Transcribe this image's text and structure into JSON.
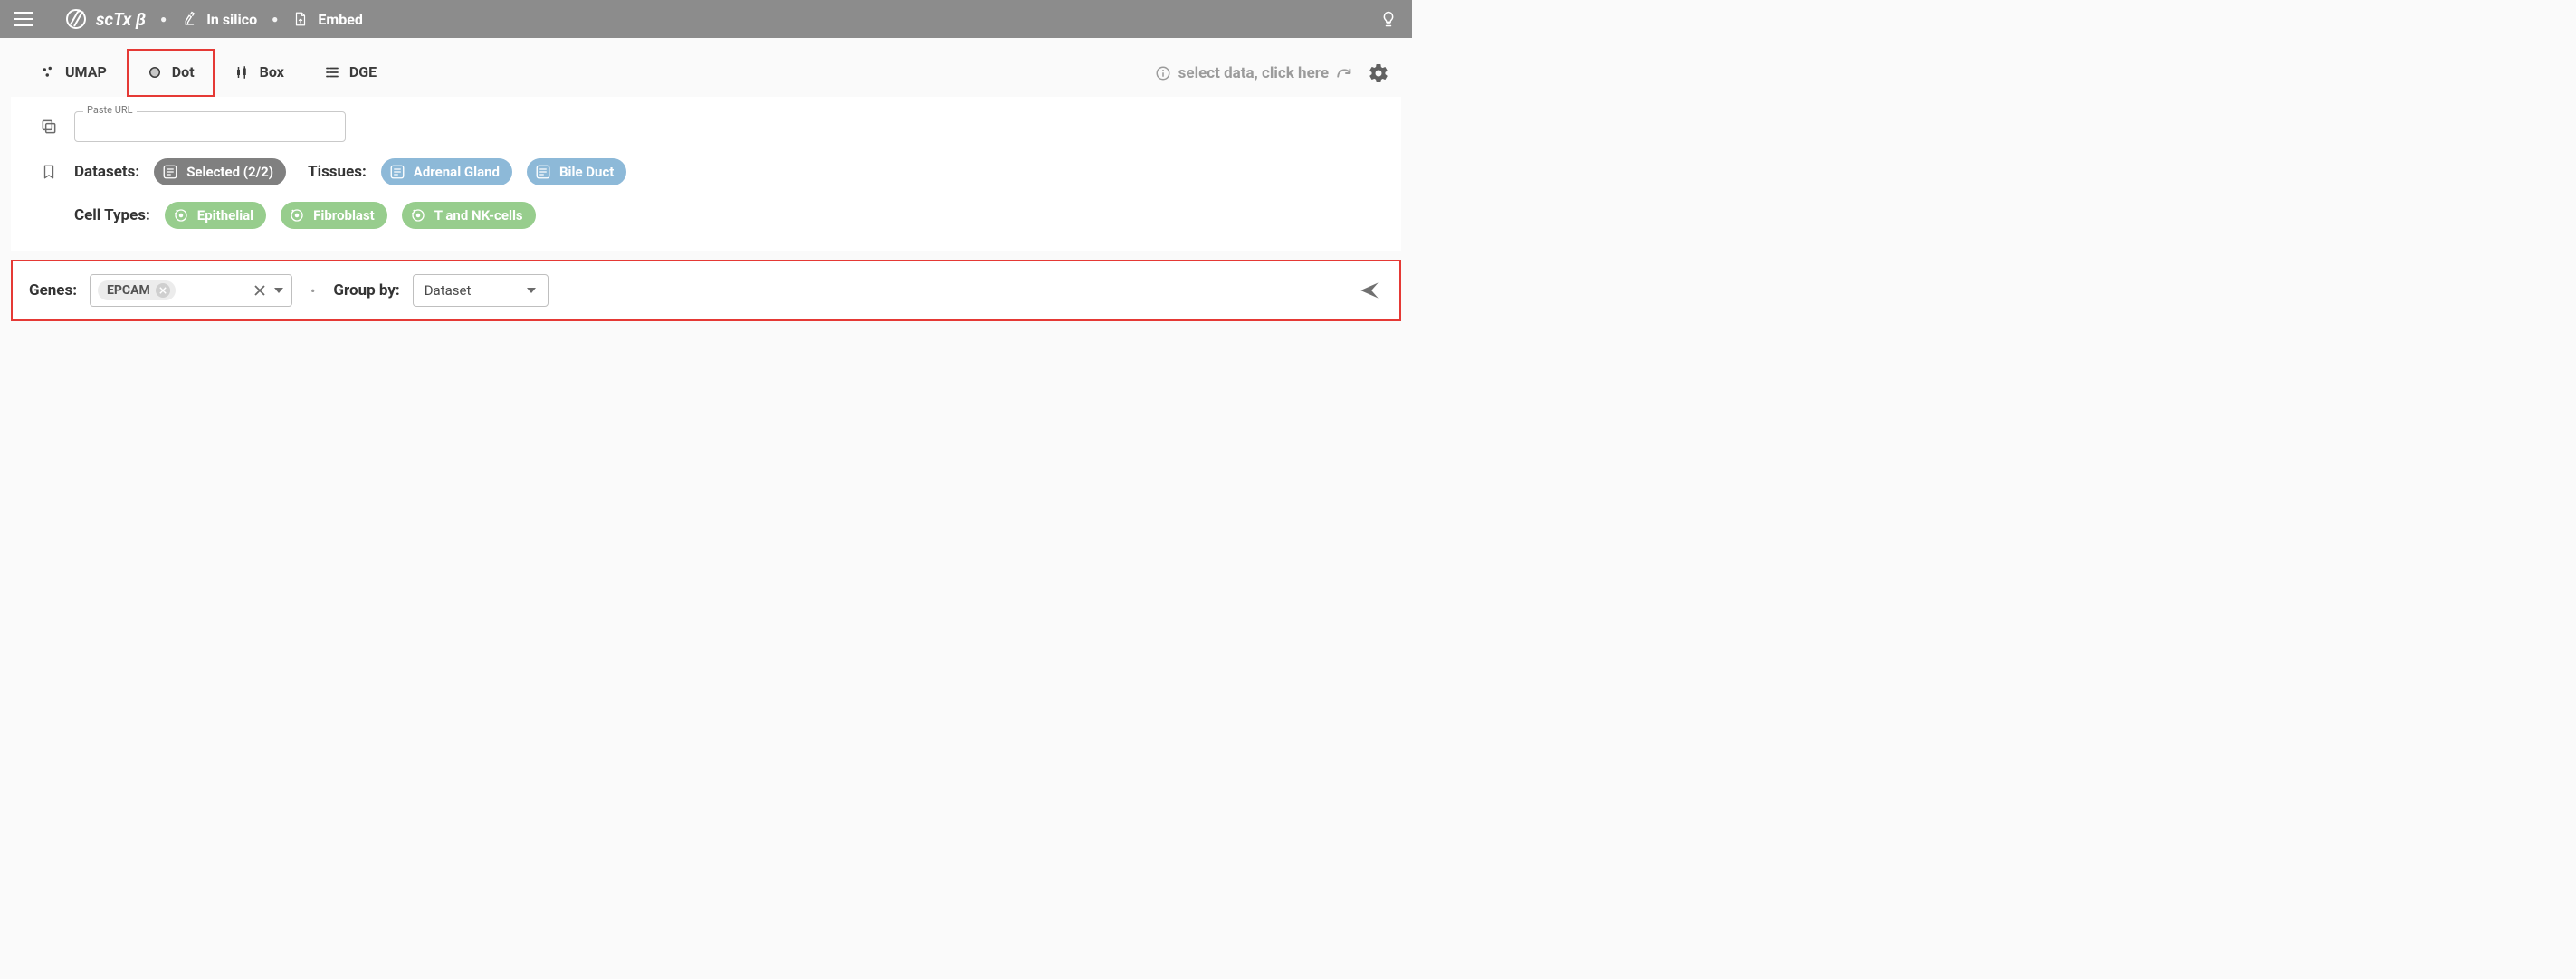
{
  "header": {
    "brand": "scTx β",
    "nav": [
      {
        "label": "In silico"
      },
      {
        "label": "Embed"
      }
    ]
  },
  "tabs": [
    "UMAP",
    "Dot",
    "Box",
    "DGE"
  ],
  "active_tab": "Dot",
  "hint_text": "select data, click here",
  "url_field": {
    "legend": "Paste URL",
    "value": ""
  },
  "datasets": {
    "label": "Datasets:",
    "chip_label": "Selected (2/2)"
  },
  "tissues": {
    "label": "Tissues:",
    "items": [
      "Adrenal Gland",
      "Bile Duct"
    ]
  },
  "cell_types": {
    "label": "Cell Types:",
    "items": [
      "Epithelial",
      "Fibroblast",
      "T and NK-cells"
    ]
  },
  "genes": {
    "label": "Genes:",
    "chips": [
      "EPCAM"
    ]
  },
  "group_by": {
    "label": "Group by:",
    "selected": "Dataset"
  }
}
